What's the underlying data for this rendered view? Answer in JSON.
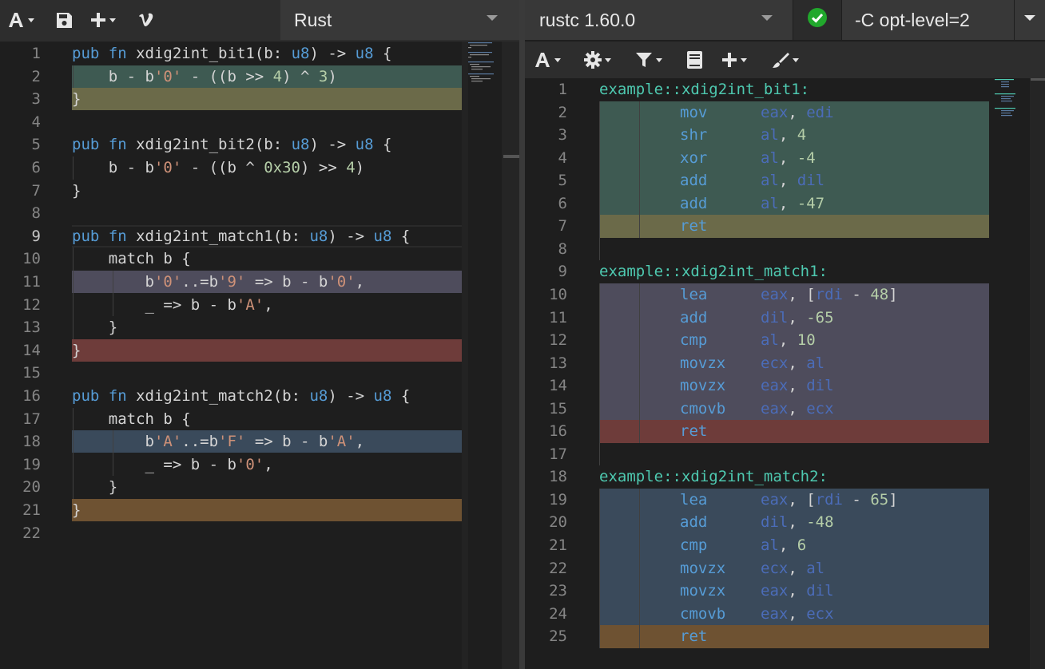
{
  "colors": {
    "hl_green": "#3e5a52",
    "hl_olive": "#6b6a49",
    "hl_purple": "#4e4c5c",
    "hl_red": "#6e3c3a",
    "hl_blue": "#3a4a5b",
    "hl_brown": "#6e5232",
    "ok_green": "#21a82c"
  },
  "left": {
    "language": "Rust",
    "toolbar_icons": [
      "font-icon",
      "save-icon",
      "add-icon",
      "vimeo-icon"
    ],
    "lines": [
      {
        "n": "1",
        "t": [
          [
            "kw",
            "pub"
          ],
          [
            "p",
            " "
          ],
          [
            "kw",
            "fn"
          ],
          [
            "p",
            " xdig2int_bit1(b: "
          ],
          [
            "ty",
            "u8"
          ],
          [
            "p",
            ") -> "
          ],
          [
            "ty",
            "u8"
          ],
          [
            "p",
            " {"
          ]
        ]
      },
      {
        "n": "2",
        "t": [
          [
            "p",
            "    b - b"
          ],
          [
            "str",
            "'0'"
          ],
          [
            "p",
            " - ((b >> "
          ],
          [
            "num",
            "4"
          ],
          [
            "p",
            ") ^ "
          ],
          [
            "num",
            "3"
          ],
          [
            "p",
            ")"
          ]
        ]
      },
      {
        "n": "3",
        "t": [
          [
            "p",
            "}"
          ]
        ]
      },
      {
        "n": "4",
        "t": []
      },
      {
        "n": "5",
        "t": [
          [
            "kw",
            "pub"
          ],
          [
            "p",
            " "
          ],
          [
            "kw",
            "fn"
          ],
          [
            "p",
            " xdig2int_bit2(b: "
          ],
          [
            "ty",
            "u8"
          ],
          [
            "p",
            ") -> "
          ],
          [
            "ty",
            "u8"
          ],
          [
            "p",
            " {"
          ]
        ]
      },
      {
        "n": "6",
        "t": [
          [
            "p",
            "    b - b"
          ],
          [
            "str",
            "'0'"
          ],
          [
            "p",
            " - ((b ^ "
          ],
          [
            "num",
            "0x30"
          ],
          [
            "p",
            ") >> "
          ],
          [
            "num",
            "4"
          ],
          [
            "p",
            ")"
          ]
        ]
      },
      {
        "n": "7",
        "t": [
          [
            "p",
            "}"
          ]
        ]
      },
      {
        "n": "8",
        "t": []
      },
      {
        "n": "9",
        "t": [
          [
            "kw",
            "pub"
          ],
          [
            "p",
            " "
          ],
          [
            "kw",
            "fn"
          ],
          [
            "p",
            " xdig2int_match1(b: "
          ],
          [
            "ty",
            "u8"
          ],
          [
            "p",
            ") -> "
          ],
          [
            "ty",
            "u8"
          ],
          [
            "p",
            " {"
          ]
        ]
      },
      {
        "n": "10",
        "t": [
          [
            "p",
            "    match b {"
          ]
        ]
      },
      {
        "n": "11",
        "t": [
          [
            "p",
            "        b"
          ],
          [
            "str",
            "'0'"
          ],
          [
            "p",
            "..=b"
          ],
          [
            "str",
            "'9'"
          ],
          [
            "p",
            " => b - b"
          ],
          [
            "str",
            "'0'"
          ],
          [
            "p",
            ","
          ]
        ]
      },
      {
        "n": "12",
        "t": [
          [
            "p",
            "        _ => b - b"
          ],
          [
            "str",
            "'A'"
          ],
          [
            "p",
            ","
          ]
        ]
      },
      {
        "n": "13",
        "t": [
          [
            "p",
            "    }"
          ]
        ]
      },
      {
        "n": "14",
        "t": [
          [
            "p",
            "}"
          ]
        ]
      },
      {
        "n": "15",
        "t": []
      },
      {
        "n": "16",
        "t": [
          [
            "kw",
            "pub"
          ],
          [
            "p",
            " "
          ],
          [
            "kw",
            "fn"
          ],
          [
            "p",
            " xdig2int_match2(b: "
          ],
          [
            "ty",
            "u8"
          ],
          [
            "p",
            ") -> "
          ],
          [
            "ty",
            "u8"
          ],
          [
            "p",
            " {"
          ]
        ]
      },
      {
        "n": "17",
        "t": [
          [
            "p",
            "    match b {"
          ]
        ]
      },
      {
        "n": "18",
        "t": [
          [
            "p",
            "        b"
          ],
          [
            "str",
            "'A'"
          ],
          [
            "p",
            "..=b"
          ],
          [
            "str",
            "'F'"
          ],
          [
            "p",
            " => b - b"
          ],
          [
            "str",
            "'A'"
          ],
          [
            "p",
            ","
          ]
        ]
      },
      {
        "n": "19",
        "t": [
          [
            "p",
            "        _ => b - b"
          ],
          [
            "str",
            "'0'"
          ],
          [
            "p",
            ","
          ]
        ]
      },
      {
        "n": "20",
        "t": [
          [
            "p",
            "    }"
          ]
        ]
      },
      {
        "n": "21",
        "t": [
          [
            "p",
            "}"
          ]
        ]
      },
      {
        "n": "22",
        "t": []
      }
    ],
    "highlights": [
      {
        "line": 2,
        "color": "hl_green"
      },
      {
        "line": 3,
        "color": "hl_olive"
      },
      {
        "line": 11,
        "color": "hl_purple"
      },
      {
        "line": 14,
        "color": "hl_red"
      },
      {
        "line": 18,
        "color": "hl_blue"
      },
      {
        "line": 21,
        "color": "hl_brown"
      }
    ]
  },
  "right": {
    "compiler": "rustc 1.60.0",
    "status": "ok",
    "compiler_options": "-C opt-level=2",
    "toolbar_icons": [
      "font-icon",
      "gear-icon",
      "filter-icon",
      "book-icon",
      "add-icon",
      "brush-icon"
    ],
    "lines": [
      {
        "n": "1",
        "lbl": "example::xdig2int_bit1:"
      },
      {
        "n": "2",
        "op": "mov",
        "args": [
          [
            "reg",
            "eax"
          ],
          [
            "p",
            ", "
          ],
          [
            "reg",
            "edi"
          ]
        ]
      },
      {
        "n": "3",
        "op": "shr",
        "args": [
          [
            "reg",
            "al"
          ],
          [
            "p",
            ", "
          ],
          [
            "num",
            "4"
          ]
        ]
      },
      {
        "n": "4",
        "op": "xor",
        "args": [
          [
            "reg",
            "al"
          ],
          [
            "p",
            ", "
          ],
          [
            "num",
            "-4"
          ]
        ]
      },
      {
        "n": "5",
        "op": "add",
        "args": [
          [
            "reg",
            "al"
          ],
          [
            "p",
            ", "
          ],
          [
            "reg",
            "dil"
          ]
        ]
      },
      {
        "n": "6",
        "op": "add",
        "args": [
          [
            "reg",
            "al"
          ],
          [
            "p",
            ", "
          ],
          [
            "num",
            "-47"
          ]
        ]
      },
      {
        "n": "7",
        "op": "ret",
        "args": []
      },
      {
        "n": "8"
      },
      {
        "n": "9",
        "lbl": "example::xdig2int_match1:"
      },
      {
        "n": "10",
        "op": "lea",
        "args": [
          [
            "reg",
            "eax"
          ],
          [
            "p",
            ", ["
          ],
          [
            "reg",
            "rdi"
          ],
          [
            "p",
            " - "
          ],
          [
            "num",
            "48"
          ],
          [
            "p",
            "]"
          ]
        ]
      },
      {
        "n": "11",
        "op": "add",
        "args": [
          [
            "reg",
            "dil"
          ],
          [
            "p",
            ", "
          ],
          [
            "num",
            "-65"
          ]
        ]
      },
      {
        "n": "12",
        "op": "cmp",
        "args": [
          [
            "reg",
            "al"
          ],
          [
            "p",
            ", "
          ],
          [
            "num",
            "10"
          ]
        ]
      },
      {
        "n": "13",
        "op": "movzx",
        "args": [
          [
            "reg",
            "ecx"
          ],
          [
            "p",
            ", "
          ],
          [
            "reg",
            "al"
          ]
        ]
      },
      {
        "n": "14",
        "op": "movzx",
        "args": [
          [
            "reg",
            "eax"
          ],
          [
            "p",
            ", "
          ],
          [
            "reg",
            "dil"
          ]
        ]
      },
      {
        "n": "15",
        "op": "cmovb",
        "args": [
          [
            "reg",
            "eax"
          ],
          [
            "p",
            ", "
          ],
          [
            "reg",
            "ecx"
          ]
        ]
      },
      {
        "n": "16",
        "op": "ret",
        "args": []
      },
      {
        "n": "17"
      },
      {
        "n": "18",
        "lbl": "example::xdig2int_match2:"
      },
      {
        "n": "19",
        "op": "lea",
        "args": [
          [
            "reg",
            "eax"
          ],
          [
            "p",
            ", ["
          ],
          [
            "reg",
            "rdi"
          ],
          [
            "p",
            " - "
          ],
          [
            "num",
            "65"
          ],
          [
            "p",
            "]"
          ]
        ]
      },
      {
        "n": "20",
        "op": "add",
        "args": [
          [
            "reg",
            "dil"
          ],
          [
            "p",
            ", "
          ],
          [
            "num",
            "-48"
          ]
        ]
      },
      {
        "n": "21",
        "op": "cmp",
        "args": [
          [
            "reg",
            "al"
          ],
          [
            "p",
            ", "
          ],
          [
            "num",
            "6"
          ]
        ]
      },
      {
        "n": "22",
        "op": "movzx",
        "args": [
          [
            "reg",
            "ecx"
          ],
          [
            "p",
            ", "
          ],
          [
            "reg",
            "al"
          ]
        ]
      },
      {
        "n": "23",
        "op": "movzx",
        "args": [
          [
            "reg",
            "eax"
          ],
          [
            "p",
            ", "
          ],
          [
            "reg",
            "dil"
          ]
        ]
      },
      {
        "n": "24",
        "op": "cmovb",
        "args": [
          [
            "reg",
            "eax"
          ],
          [
            "p",
            ", "
          ],
          [
            "reg",
            "ecx"
          ]
        ]
      },
      {
        "n": "25",
        "op": "ret",
        "args": []
      }
    ],
    "highlights": [
      {
        "from": 2,
        "to": 6,
        "color": "hl_green"
      },
      {
        "from": 7,
        "to": 7,
        "color": "hl_olive"
      },
      {
        "from": 10,
        "to": 15,
        "color": "hl_purple"
      },
      {
        "from": 16,
        "to": 16,
        "color": "hl_red"
      },
      {
        "from": 19,
        "to": 24,
        "color": "hl_blue"
      },
      {
        "from": 25,
        "to": 25,
        "color": "hl_brown"
      }
    ]
  }
}
